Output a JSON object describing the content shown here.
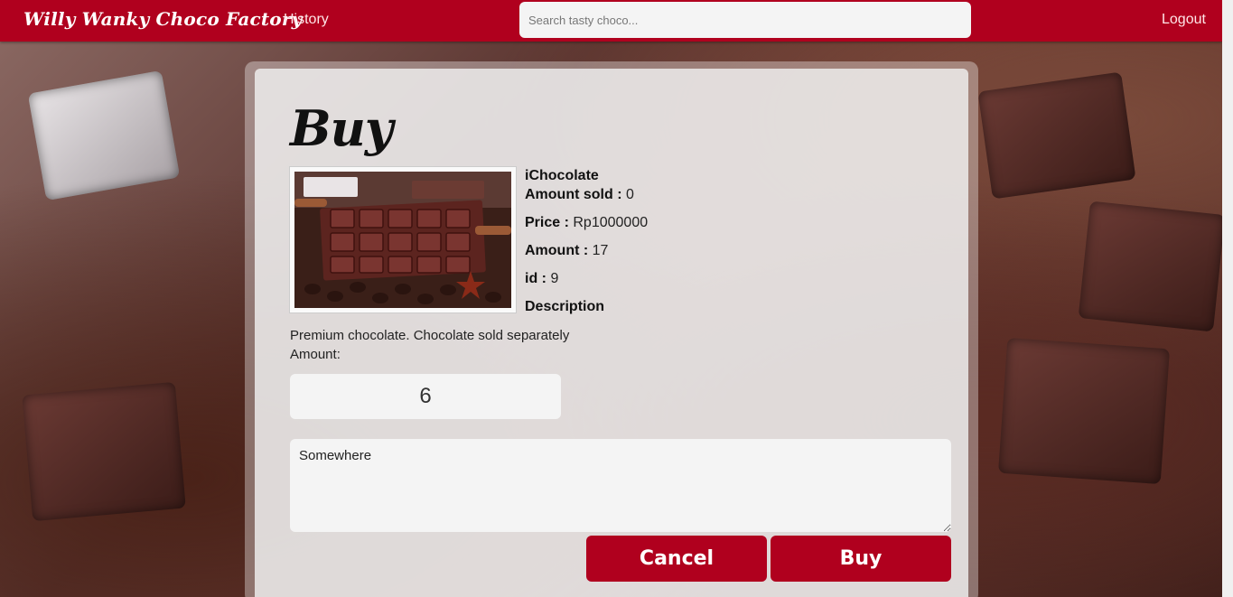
{
  "navbar": {
    "brand": "Willy Wanky Choco Factory",
    "history_label": "History",
    "search_placeholder": "Search tasty choco...",
    "logout_label": "Logout"
  },
  "page": {
    "title": "Buy"
  },
  "product": {
    "name": "iChocolate",
    "amount_sold_label": "Amount sold :",
    "amount_sold": "0",
    "price_label": "Price :",
    "price": "Rp1000000",
    "amount_label": "Amount :",
    "amount": "17",
    "id_label": "id :",
    "id": "9",
    "description_label": "Description",
    "description": "Premium chocolate. Chocolate sold separately",
    "image_icon": "chocolate-bar-image"
  },
  "form": {
    "amount_field_label": "Amount:",
    "amount_value": "6",
    "address_value": "Somewhere",
    "cancel_label": "Cancel",
    "buy_label": "Buy"
  },
  "colors": {
    "brand_red": "#b0001e",
    "card_bg": "#f0f0f0"
  }
}
